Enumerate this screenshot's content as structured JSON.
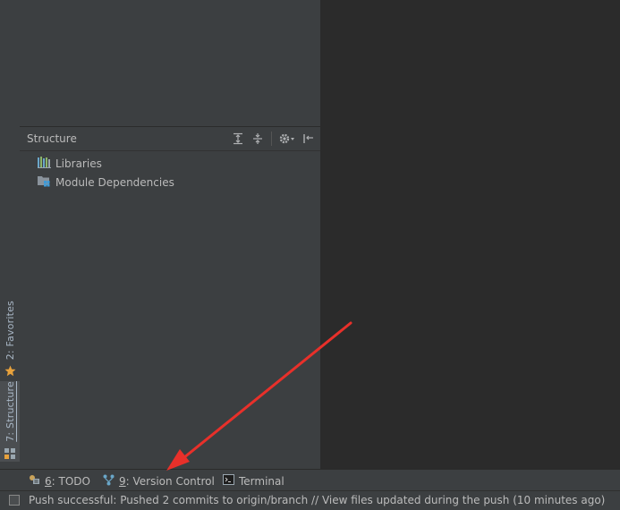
{
  "left_strip": {
    "favorites_tab": "2: Favorites",
    "structure_tab": "7: Structure"
  },
  "structure_panel": {
    "title": "Structure",
    "tools": [
      "expand-all-icon",
      "collapse-all-icon",
      "settings-icon",
      "hide-icon"
    ],
    "items": [
      {
        "label": "Libraries",
        "icon": "libraries-icon"
      },
      {
        "label": "Module Dependencies",
        "icon": "module-dependencies-icon"
      }
    ]
  },
  "bottom_bar": {
    "tabs": [
      {
        "key": "6",
        "label": ": TODO",
        "icon": "todo-icon"
      },
      {
        "key": "9",
        "label": ": Version Control",
        "icon": "version-control-icon"
      },
      {
        "key": "",
        "label": "Terminal",
        "icon": "terminal-icon"
      }
    ]
  },
  "status_bar": {
    "message": "Push successful: Pushed 2 commits to origin/branch // View files updated during the push (10 minutes ago)"
  },
  "colors": {
    "panel_bg": "#3c3f41",
    "editor_bg": "#2b2b2b",
    "text": "#bbbbbb",
    "annotation_arrow": "#e8302a",
    "favorites_star": "#e8a23c"
  }
}
